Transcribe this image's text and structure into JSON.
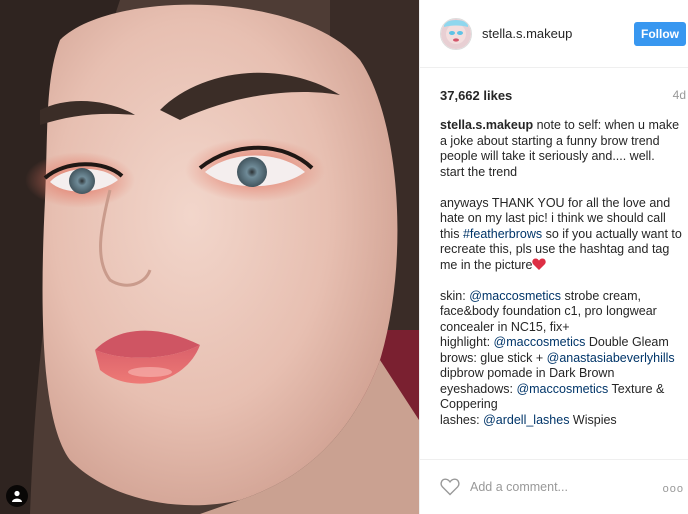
{
  "photo": {
    "alt_icon": "person-tag-icon"
  },
  "header": {
    "username": "stella.s.makeup",
    "follow_label": "Follow",
    "avatar_icon": "avatar-image"
  },
  "stats": {
    "likes": "37,662 likes",
    "time": "4d"
  },
  "caption": {
    "author": "stella.s.makeup",
    "p1_text": "note to self: when u make a joke about starting a funny brow trend people will take it seriously and.... well. start the trend",
    "p2_a": "anyways THANK YOU for all the love and hate on my last pic! i think we should call this ",
    "p2_hashtag": "#featherbrows",
    "p2_b": " so if you actually want to recreate this, pls use the hashtag and tag me in the picture",
    "skin_label": "skin: ",
    "skin_mention": "@maccosmetics",
    "skin_text": " strobe cream, face&body foundation c1, pro longwear concealer in NC15, fix+",
    "highlight_label": "highlight: ",
    "highlight_mention": "@maccosmetics",
    "highlight_text": " Double Gleam",
    "brows_label": "brows: glue stick + ",
    "brows_mention": "@anastasiabeverlyhills",
    "brows_text": " dipbrow pomade in Dark Brown",
    "eyes_label": "eyeshadows: ",
    "eyes_mention": "@maccosmetics",
    "eyes_text": " Texture & Coppering",
    "lashes_label": "lashes: ",
    "lashes_mention": "@ardell_lashes",
    "lashes_text": " Wispies"
  },
  "comment": {
    "placeholder": "Add a comment...",
    "more": "ooo"
  },
  "colors": {
    "follow_bg": "#3897f0",
    "link": "#003569",
    "muted": "#999999"
  }
}
